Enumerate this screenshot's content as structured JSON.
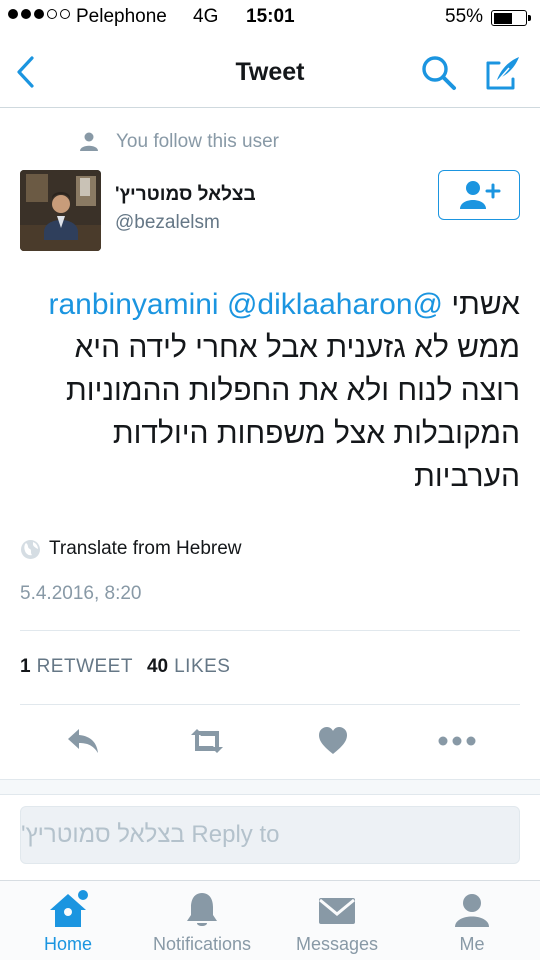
{
  "status_bar": {
    "carrier": "Pelephone",
    "network": "4G",
    "time": "15:01",
    "battery": "55%",
    "battery_level": 0.55,
    "signal_bars_filled": 3,
    "signal_bars_total": 5
  },
  "nav": {
    "title": "Tweet",
    "back_icon": "chevron-left-icon",
    "search_icon": "search-icon",
    "compose_icon": "compose-tweet-icon"
  },
  "social_context": {
    "text": "You follow this user",
    "icon": "person-icon"
  },
  "author": {
    "name": "בצלאל סמוטריץ'",
    "handle": "@bezalelsm",
    "avatar": "author-avatar"
  },
  "follow_button": {
    "icon": "follow-user-icon"
  },
  "tweet": {
    "mention_1": "@diklaaharon",
    "mention_2": "@ranbinyamini",
    "body_prefix": "אשתי",
    "body": "ממש לא גזענית אבל אחרי לידה היא רוצה לנוח ולא את החפלות ההמוניות המקובלות אצל משפחות היולדות הערביות",
    "translate_label": "Translate from Hebrew",
    "timestamp": "5.4.2016, 8:20"
  },
  "stats": {
    "retweets_count": "1",
    "retweets_label": "RETWEET",
    "likes_count": "40",
    "likes_label": "LIKES"
  },
  "actions": [
    {
      "name": "reply",
      "icon": "reply-icon"
    },
    {
      "name": "retweet",
      "icon": "retweet-icon"
    },
    {
      "name": "like",
      "icon": "heart-icon"
    },
    {
      "name": "more",
      "icon": "more-icon"
    }
  ],
  "reply_box": {
    "placeholder": "Reply to בצלאל סמוטריץ'"
  },
  "tab_bar": {
    "tabs": [
      {
        "label": "Home",
        "icon": "home-icon",
        "active": true,
        "has_badge": true
      },
      {
        "label": "Notifications",
        "icon": "bell-icon",
        "active": false
      },
      {
        "label": "Messages",
        "icon": "envelope-icon",
        "active": false
      },
      {
        "label": "Me",
        "icon": "person-icon",
        "active": false
      }
    ]
  },
  "colors": {
    "accent": "#1b95e0",
    "text_primary": "#14171a",
    "text_secondary": "#657786",
    "icon_gray": "#8899a6"
  }
}
